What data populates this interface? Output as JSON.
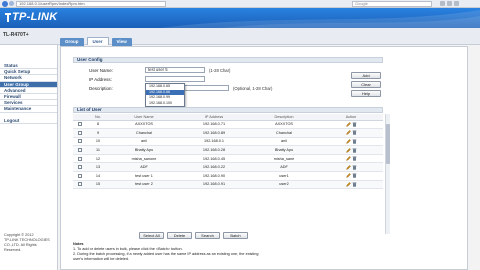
{
  "browser": {
    "address": "192.168.0.1/userRpm/IndexRpm.htm",
    "search_placeholder": "Google"
  },
  "header": {
    "logo": "TP-LINK"
  },
  "model": "TL-R470T+",
  "tabs": [
    {
      "label": "Group"
    },
    {
      "label": "User"
    },
    {
      "label": "View"
    }
  ],
  "sidebar": {
    "items": [
      {
        "label": "Status"
      },
      {
        "label": "Quick Setup"
      },
      {
        "label": "Network"
      },
      {
        "label": "User Group"
      },
      {
        "label": "Advanced"
      },
      {
        "label": "Firewall"
      },
      {
        "label": "Services"
      },
      {
        "label": "Maintenance"
      },
      {
        "label": "Logout"
      }
    ],
    "copyright": [
      "Copyright © 2012",
      "TP-LINK TECHNOLOGIES",
      "CO.,LTD. All Rights",
      "Reserved."
    ]
  },
  "user_config": {
    "title": "User Config",
    "user_name_label": "User Name:",
    "user_name_value": "test user 5",
    "user_name_hint": "(1-28 Char)",
    "ip_label": "IP Address:",
    "ip_options": [
      "192.168.0.65",
      "192.168.0.66",
      "192.168.0.99",
      "192.168.0.100"
    ],
    "description_label": "Description:",
    "description_hint": "(Optional, 1-28 Char)",
    "buttons": {
      "add": "Add",
      "clear": "Clear",
      "help": "Help"
    }
  },
  "user_list": {
    "title": "List of User",
    "columns": [
      "",
      "No.",
      "User Name",
      "IP Address",
      "Description",
      "Action"
    ],
    "rows": [
      {
        "no": "8",
        "name": "AXXXTOS",
        "ip": "192.168.0.71",
        "desc": "AXXXTOS"
      },
      {
        "no": "9",
        "name": "Chanchal",
        "ip": "192.168.0.89",
        "desc": "Chanchal"
      },
      {
        "no": "10",
        "name": "anil",
        "ip": "192.168.0.1",
        "desc": "anil"
      },
      {
        "no": "11",
        "name": "Bhatty Apu",
        "ip": "192.168.0.28",
        "desc": "Bhatty Apu"
      },
      {
        "no": "12",
        "name": "misha_sanone",
        "ip": "192.168.0.45",
        "desc": "misha_sane"
      },
      {
        "no": "13",
        "name": "ADF",
        "ip": "192.168.0.22",
        "desc": "ADF"
      },
      {
        "no": "14",
        "name": "test user 1",
        "ip": "192.168.0.90",
        "desc": "user1"
      },
      {
        "no": "15",
        "name": "test user 2",
        "ip": "192.168.0.91",
        "desc": "user2"
      }
    ],
    "buttons": {
      "select_all": "Select All",
      "delete": "Delete",
      "search": "Search",
      "batch": "Batch"
    }
  },
  "notes": {
    "title": "Notes",
    "lines": [
      "1. To add or delete users in bulk, please click the <Batch> button.",
      "2. During the batch processing, if a newly added user has the same IP address as an existing one, the existing",
      "   user's information will be deleted."
    ]
  },
  "colors": {
    "brand_blue": "#1a6fd1",
    "sidebar_active": "#3e6faa",
    "dropdown_selected": "#3b6fb6"
  }
}
